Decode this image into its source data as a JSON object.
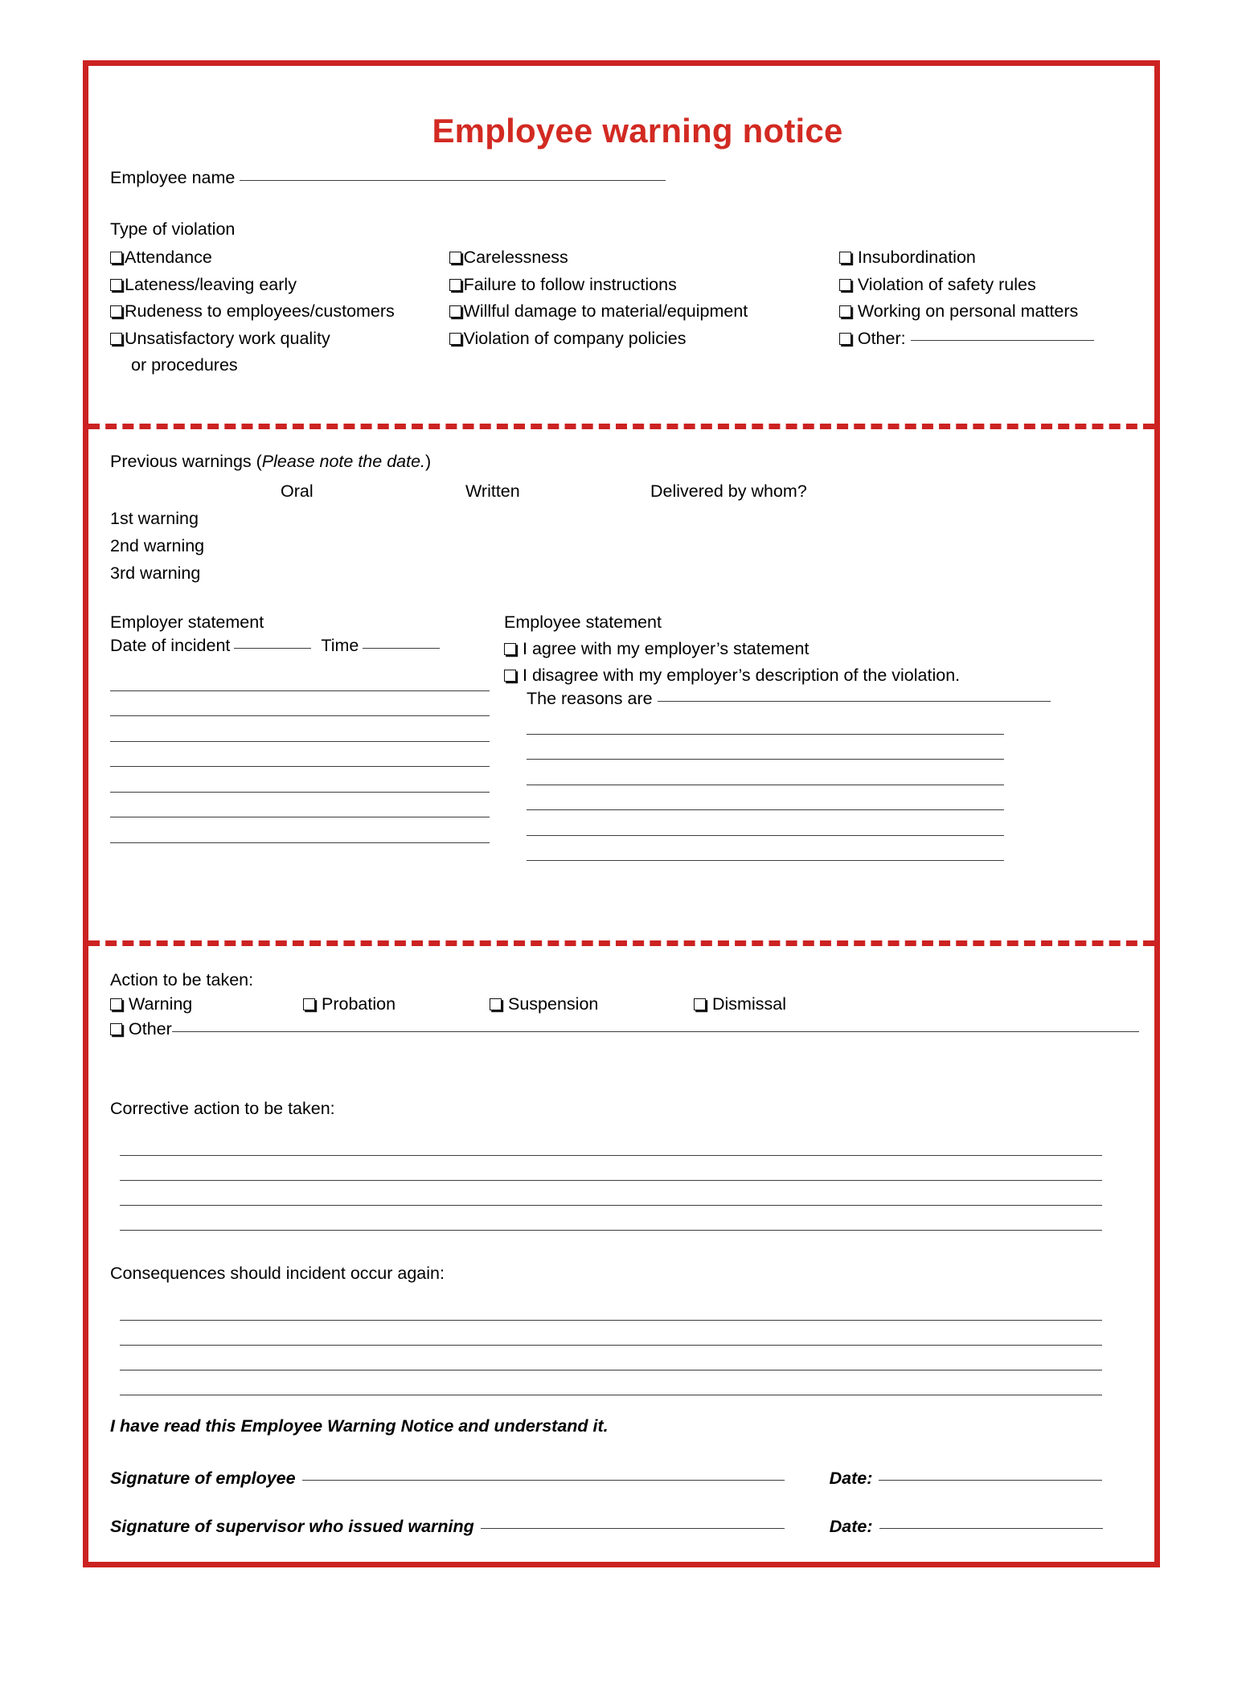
{
  "title": "Employee warning notice",
  "accent_color": "#CC2222",
  "title_color": "#D22A22",
  "employee_name": {
    "label": "Employee name",
    "value": ""
  },
  "violations": {
    "heading": "Type of violation",
    "column1": [
      "Attendance",
      "Lateness/leaving early",
      "Rudeness to employees/customers",
      "Unsatisfactory work quality",
      "or procedures"
    ],
    "column2": [
      "Carelessness",
      "Failure to follow instructions",
      "Willful damage to material/equipment",
      "Violation of company policies"
    ],
    "column3": [
      "Insubordination",
      "Violation of safety rules",
      "Working on personal matters",
      "Other:"
    ],
    "other_value": ""
  },
  "previous_warnings": {
    "title_main": "Previous warnings (",
    "title_italic": "Please note the date.",
    "title_end": ")",
    "columns": [
      "Oral",
      "Written",
      "Delivered by whom?"
    ],
    "rows": [
      {
        "label": "1st warning",
        "oral": "",
        "written": "",
        "delivered_by": ""
      },
      {
        "label": "2nd warning",
        "oral": "",
        "written": "",
        "delivered_by": ""
      },
      {
        "label": "3rd warning",
        "oral": "",
        "written": "",
        "delivered_by": ""
      }
    ]
  },
  "employer_statement": {
    "title": "Employer statement",
    "date_label": "Date of incident",
    "date_value": "",
    "time_label": "Time",
    "time_value": "",
    "blank_line_count": 7
  },
  "employee_statement": {
    "title": "Employee statement",
    "agree_option": "I agree with my employer’s statement",
    "disagree_option": "I disagree with my employer’s description of the violation.",
    "reasons_label": "The reasons are",
    "reasons_value": "",
    "blank_line_count": 6
  },
  "action": {
    "title": "Action to be taken:",
    "options": [
      "Warning",
      "Probation",
      "Suspension",
      "Dismissal"
    ],
    "other_label": "Other",
    "other_value": ""
  },
  "corrective_action": {
    "title": "Corrective action to be taken:",
    "value": "",
    "line_count": 4
  },
  "consequences": {
    "title": "Consequences should incident occur again:",
    "value": "",
    "line_count": 4
  },
  "acknowledgement": "I have read this Employee Warning Notice and understand it.",
  "signatures": {
    "employee_label": "Signature of employee",
    "employee_value": "",
    "employee_date_label": "Date:",
    "employee_date_value": "",
    "supervisor_label": "Signature of supervisor who issued warning",
    "supervisor_value": "",
    "supervisor_date_label": "Date:",
    "supervisor_date_value": ""
  }
}
